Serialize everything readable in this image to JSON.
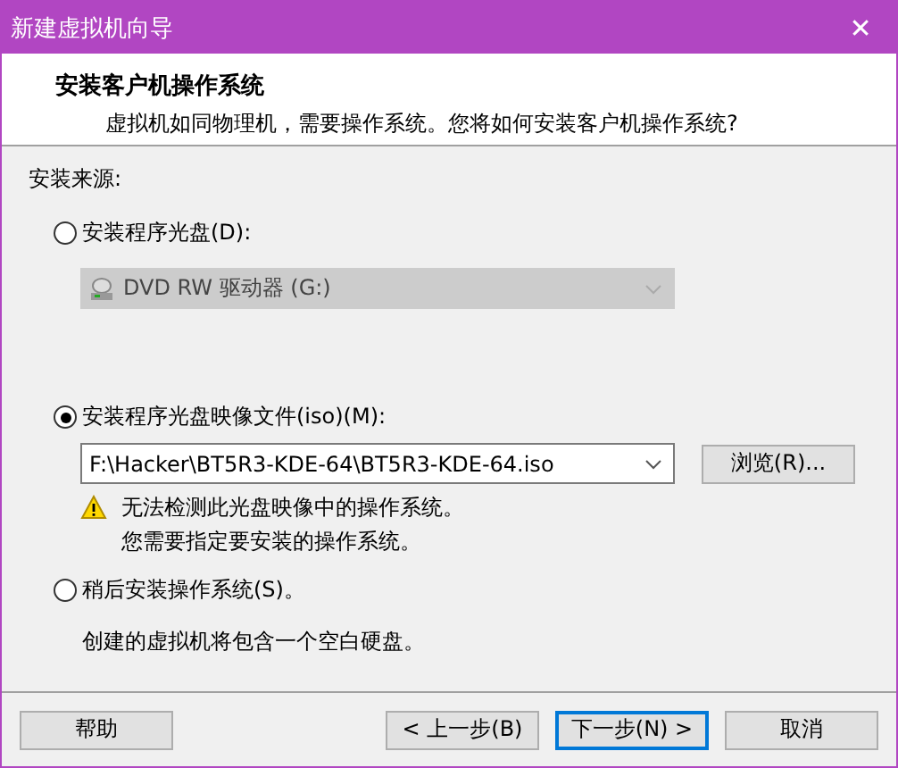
{
  "window": {
    "title": "新建虚拟机向导",
    "close": "✕"
  },
  "header": {
    "title": "安装客户机操作系统",
    "subtitle": "虚拟机如同物理机，需要操作系统。您将如何安装客户机操作系统?"
  },
  "source": {
    "label": "安装来源:",
    "options": [
      {
        "kind": "disc",
        "label": "安装程序光盘(D):",
        "selected": false,
        "combo": {
          "value": "DVD RW 驱动器 (G:)",
          "disabled": true
        }
      },
      {
        "kind": "iso",
        "label": "安装程序光盘映像文件(iso)(M):",
        "selected": true,
        "combo": {
          "value": "F:\\Hacker\\BT5R3-KDE-64\\BT5R3-KDE-64.iso",
          "disabled": false
        },
        "browse": "浏览(R)...",
        "warning": [
          "无法检测此光盘映像中的操作系统。",
          "您需要指定要安装的操作系统。"
        ]
      },
      {
        "kind": "later",
        "label": "稍后安装操作系统(S)。",
        "selected": false,
        "note": "创建的虚拟机将包含一个空白硬盘。"
      }
    ]
  },
  "buttons": [
    {
      "kind": "help",
      "label": "帮助",
      "default": false
    },
    {
      "kind": "back",
      "label": "< 上一步(B)",
      "default": false
    },
    {
      "kind": "next",
      "label": "下一步(N) >",
      "default": true
    },
    {
      "kind": "cancel",
      "label": "取消",
      "default": false
    }
  ]
}
